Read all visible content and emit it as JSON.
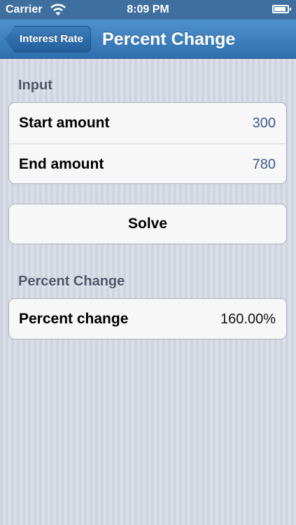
{
  "status_bar": {
    "carrier": "Carrier",
    "time": "8:09 PM",
    "battery_level": 0.9
  },
  "nav": {
    "back_label": "Interest Rate",
    "title": "Percent Change"
  },
  "input_section": {
    "header": "Input",
    "rows": [
      {
        "label": "Start amount",
        "value": "300"
      },
      {
        "label": "End amount",
        "value": "780"
      }
    ]
  },
  "solve_label": "Solve",
  "result_section": {
    "header": "Percent Change",
    "rows": [
      {
        "label": "Percent change",
        "value": "160.00%"
      }
    ]
  },
  "colors": {
    "nav_blue": "#2f6fad",
    "value_blue": "#3d5a8a",
    "section_header": "#4c566a"
  }
}
